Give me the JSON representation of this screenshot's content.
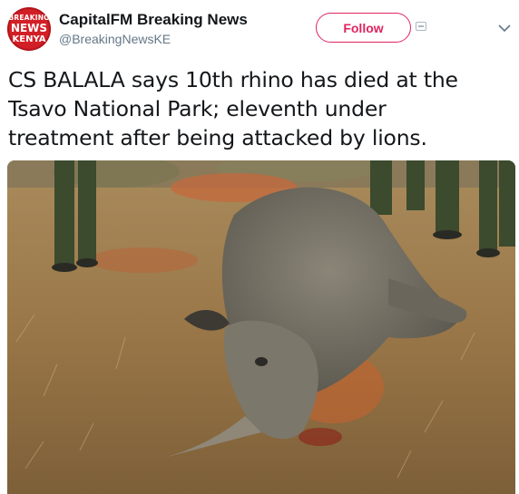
{
  "account": {
    "avatar_lines": [
      "BREAKING",
      "NEWS",
      "KENYA"
    ],
    "display_name": "CapitalFM Breaking News",
    "handle": "@BreakingNewsKE"
  },
  "actions": {
    "follow_label": "Follow"
  },
  "tweet": {
    "text": "CS BALALA says 10th rhino has died at the\nTsavo National Park; eleventh under\ntreatment after being attacked by lions."
  },
  "colors": {
    "accent": "#e0245e",
    "avatar_bg": "#d21f26",
    "muted": "#657786"
  },
  "icons": [
    "avatar",
    "notifications-icon",
    "caret-down-icon"
  ]
}
